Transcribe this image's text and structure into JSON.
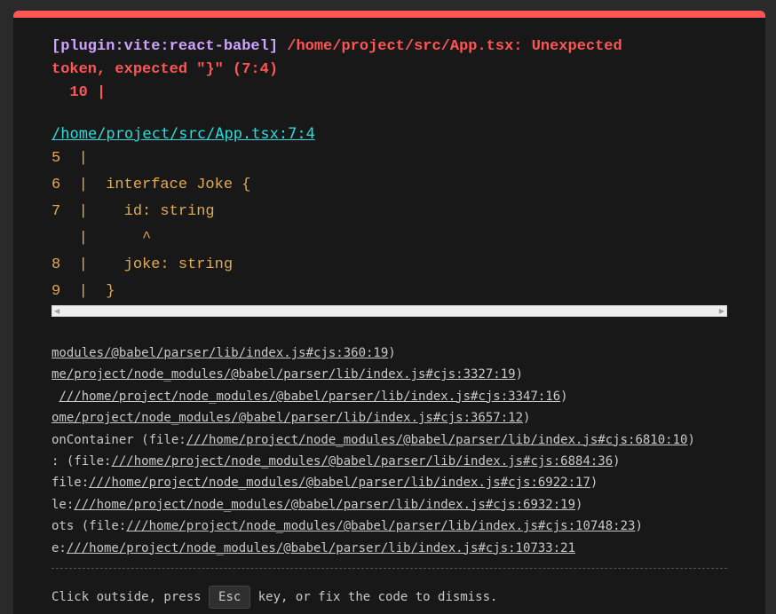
{
  "error": {
    "plugin": "[plugin:vite:react-babel]",
    "message": " /home/project/src/App.tsx: Unexpected\ntoken, expected \"}\" (7:4)\n  10 |",
    "file_link": "/home/project/src/App.tsx:7:4"
  },
  "frame": {
    "lines": [
      "5  |",
      "6  |  interface Joke {",
      "7  |    id: string",
      "   |      ^",
      "8  |    joke: string",
      "9  |  }"
    ]
  },
  "stack": {
    "lines": [
      {
        "pre": "",
        "link": "modules/@babel/parser/lib/index.js#cjs:360:19",
        "post": ")"
      },
      {
        "pre": "",
        "link": "me/project/node_modules/@babel/parser/lib/index.js#cjs:3327:19",
        "post": ")"
      },
      {
        "pre": " ",
        "link": "///home/project/node_modules/@babel/parser/lib/index.js#cjs:3347:16",
        "post": ")"
      },
      {
        "pre": "",
        "link": "ome/project/node_modules/@babel/parser/lib/index.js#cjs:3657:12",
        "post": ")"
      },
      {
        "pre": "onContainer (file:",
        "link": "///home/project/node_modules/@babel/parser/lib/index.js#cjs:6810:10",
        "post": ")"
      },
      {
        "pre": ": (file:",
        "link": "///home/project/node_modules/@babel/parser/lib/index.js#cjs:6884:36",
        "post": ")"
      },
      {
        "pre": "file:",
        "link": "///home/project/node_modules/@babel/parser/lib/index.js#cjs:6922:17",
        "post": ")"
      },
      {
        "pre": "le:",
        "link": "///home/project/node_modules/@babel/parser/lib/index.js#cjs:6932:19",
        "post": ")"
      },
      {
        "pre": "ots (file:",
        "link": "///home/project/node_modules/@babel/parser/lib/index.js#cjs:10748:23",
        "post": ")"
      },
      {
        "pre": "e:",
        "link": "///home/project/node_modules/@babel/parser/lib/index.js#cjs:10733:21",
        "post": ""
      }
    ]
  },
  "tip": {
    "prefix": "Click outside, press ",
    "key": "Esc",
    "suffix": " key, or fix the code to dismiss."
  },
  "colors": {
    "error_red": "#ff5555",
    "plugin_purple": "#cfa3ff",
    "link_cyan": "#2dd9da",
    "code_yellow": "#e2aa53",
    "background": "#181818"
  }
}
